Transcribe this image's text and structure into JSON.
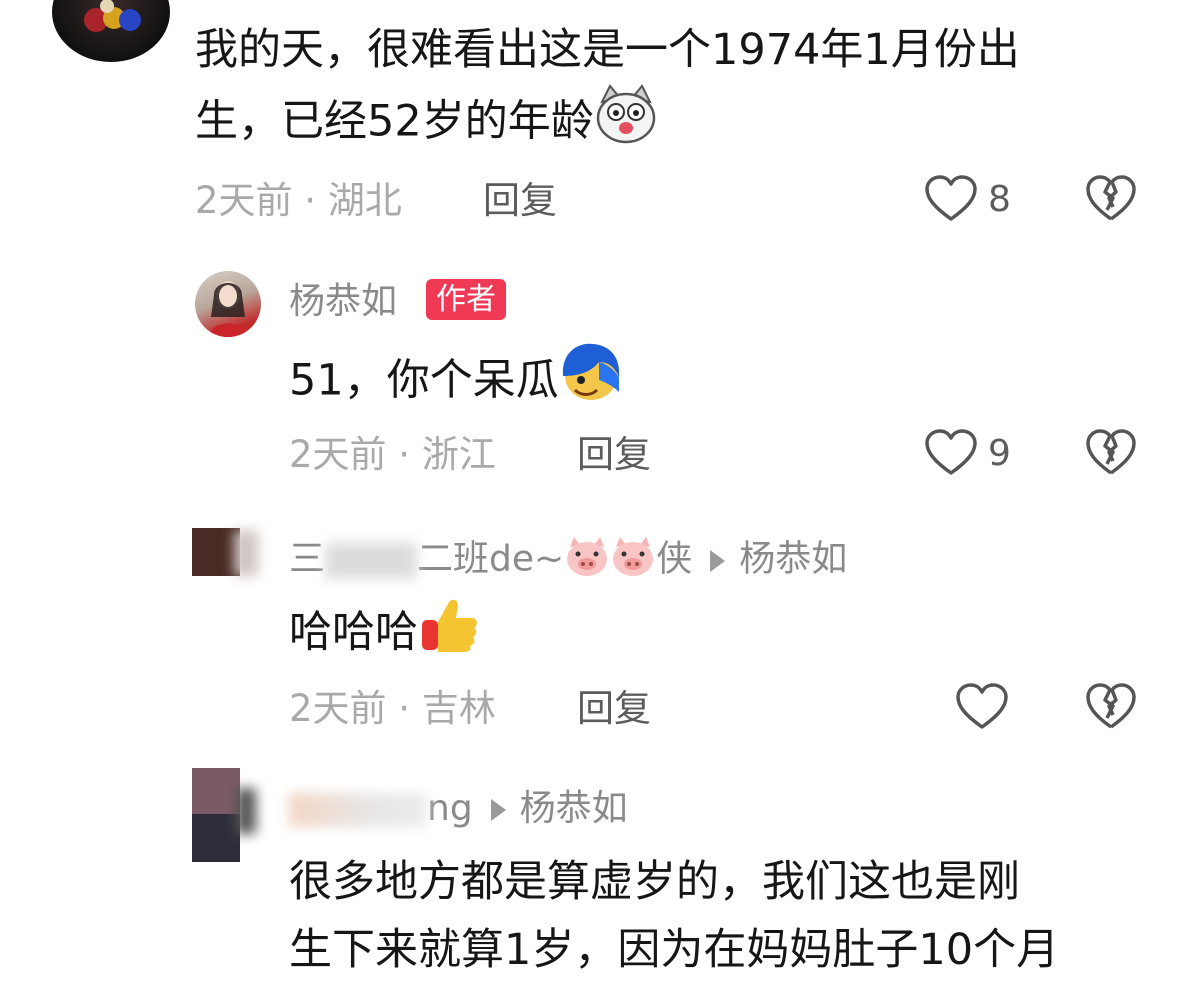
{
  "comments": [
    {
      "text_line1": "我的天，很难看出这是一个1974年1月份出",
      "text_line2": "生，已经52岁的年龄",
      "time": "2天前",
      "location": "湖北",
      "reply_label": "回复",
      "likes": "8"
    },
    {
      "username": "杨恭如",
      "badge": "作者",
      "text": "51，你个呆瓜",
      "time": "2天前",
      "location": "浙江",
      "reply_label": "回复",
      "likes": "9"
    },
    {
      "username_start": "三",
      "username_end": "二班de~",
      "username_suffix": "侠",
      "reply_to": "杨恭如",
      "text": "哈哈哈",
      "time": "2天前",
      "location": "吉林",
      "reply_label": "回复"
    },
    {
      "username_end": "ng",
      "reply_to": "杨恭如",
      "text_line1": "很多地方都是算虚岁的，我们这也是刚",
      "text_line2": "生下来就算1岁，因为在妈妈肚子10个月"
    }
  ],
  "separator": " · ",
  "icons": {
    "like": "heart-outline-icon",
    "dislike": "broken-heart-icon",
    "arrow": "reply-arrow-icon"
  },
  "colors": {
    "badge": "#f03a55",
    "meta": "#a9a9a9",
    "text": "#161616"
  }
}
